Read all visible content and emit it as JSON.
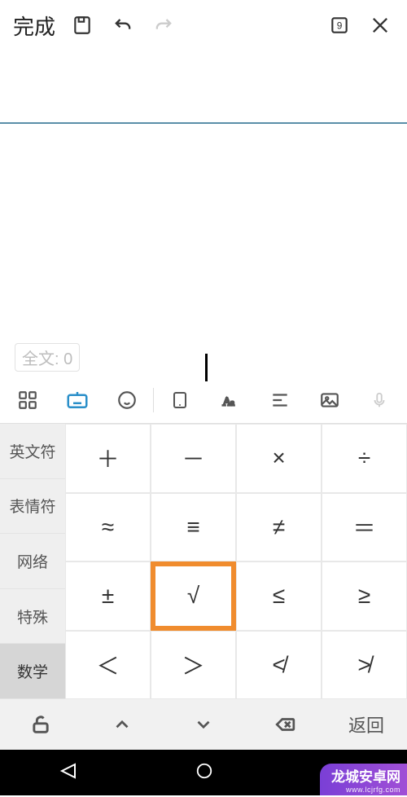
{
  "topbar": {
    "done": "完成",
    "badge": "9"
  },
  "counter": "全文: 0",
  "categories": [
    "英文符",
    "表情符",
    "网络",
    "特殊",
    "数学"
  ],
  "active_category_index": 4,
  "symbols": [
    "＋",
    "－",
    "×",
    "÷",
    "≈",
    "≡",
    "≠",
    "＝",
    "±",
    "√",
    "≤",
    "≥",
    "＜",
    "＞",
    "≮",
    "≯"
  ],
  "highlighted_symbol_index": 9,
  "bottom": {
    "back_label": "返回"
  },
  "watermark": {
    "line1": "龙城安卓网",
    "line2": "www.lcjrfg.com"
  }
}
